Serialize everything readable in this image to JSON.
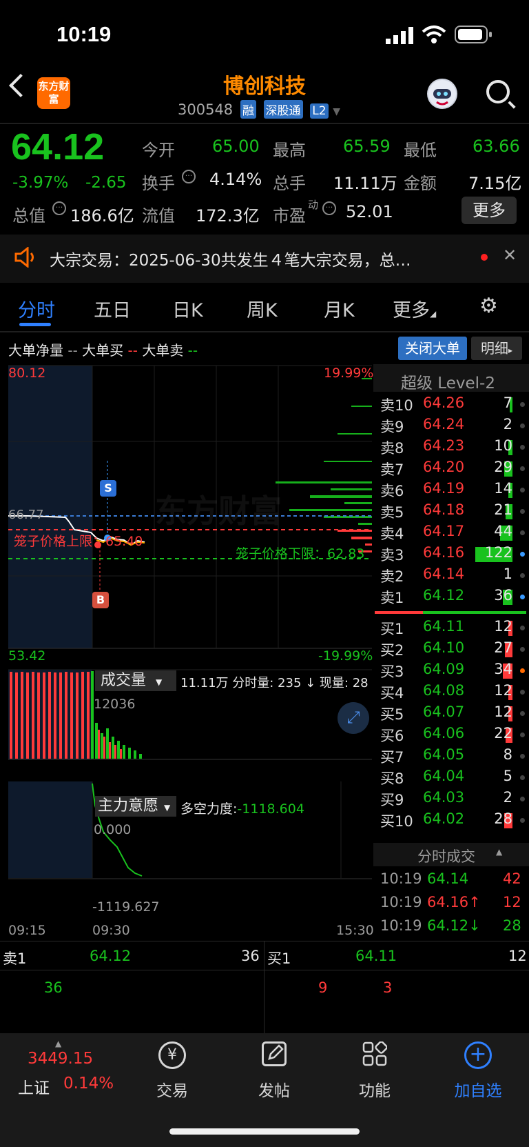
{
  "status": {
    "time": "10:19"
  },
  "header": {
    "title": "博创科技",
    "code": "300548",
    "tags": [
      "融",
      "深股通",
      "L2"
    ],
    "logo_text": "东方财富"
  },
  "quote": {
    "price": "64.12",
    "change_pct": "-3.97%",
    "change": "-2.65",
    "open_label": "今开",
    "open": "65.00",
    "high_label": "最高",
    "high": "65.59",
    "low_label": "最低",
    "low": "63.66",
    "turnover_label": "换手",
    "turnover": "4.14%",
    "volume_label": "总手",
    "volume": "11.11万",
    "amount_label": "金额",
    "amount": "7.15亿",
    "mcap_label": "总值",
    "mcap": "186.6亿",
    "float_label": "流值",
    "float": "172.3亿",
    "pe_label": "市盈",
    "pe_sup": "动",
    "pe": "52.01",
    "more_label": "更多"
  },
  "notice": {
    "text": "大宗交易：2025-06-30共发生４笔大宗交易，总…"
  },
  "tabs": [
    "分时",
    "五日",
    "日K",
    "周K",
    "月K",
    "更多"
  ],
  "indicator_bar": {
    "net": "大单净量",
    "buy": "大单买",
    "sell": "大单卖",
    "dash": "--",
    "toggle": "关闭大单",
    "detail": "明细"
  },
  "chart": {
    "top_price": "80.12",
    "top_pct": "19.99%",
    "bottom_price": "53.42",
    "bottom_pct": "-19.99%",
    "prev_close": "66.77",
    "upper_label": "笼子价格上限：65.40",
    "lower_label": "笼子价格下限：62.83",
    "s_mark": "S",
    "b_mark": "B",
    "watermark": "东方财富",
    "volume_label": "成交量",
    "volume_info": "11.11万  分时量: 235 ↓  现量: 28",
    "volume_max": "12036",
    "force_label": "主力意愿",
    "force_info_label": "多空力度:",
    "force_info_value": "-1118.604",
    "force_top": "0.000",
    "force_bottom": "-1119.627",
    "time_start": "09:15",
    "time_mid": "09:30",
    "time_end": "15:30"
  },
  "depth": {
    "title": "超级 Level-2",
    "asks": [
      {
        "label": "卖10",
        "price": "64.26",
        "vol": "7"
      },
      {
        "label": "卖9",
        "price": "64.24",
        "vol": "2"
      },
      {
        "label": "卖8",
        "price": "64.23",
        "vol": "10"
      },
      {
        "label": "卖7",
        "price": "64.20",
        "vol": "29"
      },
      {
        "label": "卖6",
        "price": "64.19",
        "vol": "14"
      },
      {
        "label": "卖5",
        "price": "64.18",
        "vol": "21"
      },
      {
        "label": "卖4",
        "price": "64.17",
        "vol": "44"
      },
      {
        "label": "卖3",
        "price": "64.16",
        "vol": "122"
      },
      {
        "label": "卖2",
        "price": "64.14",
        "vol": "1"
      },
      {
        "label": "卖1",
        "price": "64.12",
        "vol": "36"
      }
    ],
    "bids": [
      {
        "label": "买1",
        "price": "64.11",
        "vol": "12"
      },
      {
        "label": "买2",
        "price": "64.10",
        "vol": "27"
      },
      {
        "label": "买3",
        "price": "64.09",
        "vol": "34"
      },
      {
        "label": "买4",
        "price": "64.08",
        "vol": "12"
      },
      {
        "label": "买5",
        "price": "64.07",
        "vol": "12"
      },
      {
        "label": "买6",
        "price": "64.06",
        "vol": "22"
      },
      {
        "label": "买7",
        "price": "64.05",
        "vol": "8"
      },
      {
        "label": "买8",
        "price": "64.04",
        "vol": "5"
      },
      {
        "label": "买9",
        "price": "64.03",
        "vol": "2"
      },
      {
        "label": "买10",
        "price": "64.02",
        "vol": "28"
      }
    ],
    "trades_title": "分时成交",
    "trades": [
      {
        "time": "10:19",
        "price": "64.14",
        "arrow": "",
        "vol": "42"
      },
      {
        "time": "10:19",
        "price": "64.16",
        "arrow": "↑",
        "vol": "12"
      },
      {
        "time": "10:19",
        "price": "64.12",
        "arrow": "↓",
        "vol": "28"
      }
    ]
  },
  "book": {
    "sell_label": "卖1",
    "sell_price": "64.12",
    "sell_vol": "36",
    "sell_queue": [
      "36"
    ],
    "buy_label": "买1",
    "buy_price": "64.11",
    "buy_vol": "12",
    "buy_queue": [
      "9",
      "3"
    ]
  },
  "tabbar": {
    "index_value": "3449.15",
    "index_name": "上证",
    "index_pct": "0.14%",
    "trade": "交易",
    "post": "发帖",
    "functions": "功能",
    "add": "加自选"
  }
}
